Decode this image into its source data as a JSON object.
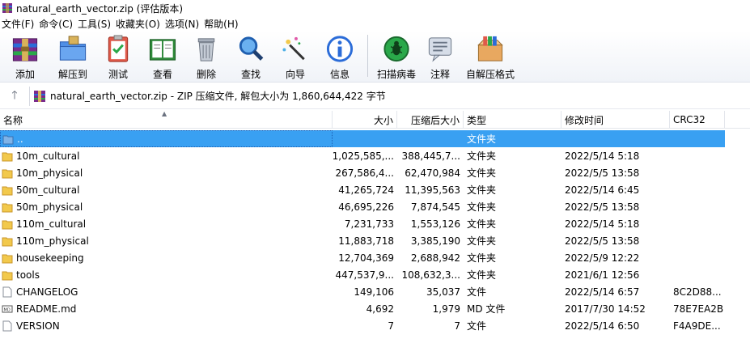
{
  "window": {
    "title": "natural_earth_vector.zip (评估版本)"
  },
  "menu": [
    "文件(F)",
    "命令(C)",
    "工具(S)",
    "收藏夹(O)",
    "选项(N)",
    "帮助(H)"
  ],
  "toolbar": {
    "add": "添加",
    "extract": "解压到",
    "test": "测试",
    "view": "查看",
    "delete": "删除",
    "find": "查找",
    "wizard": "向导",
    "info": "信息",
    "scan": "扫描病毒",
    "comment": "注释",
    "sfx": "自解压格式"
  },
  "address": {
    "path": "natural_earth_vector.zip - ZIP 压缩文件, 解包大小为 1,860,644,422 字节"
  },
  "columns": {
    "name": "名称",
    "size": "大小",
    "packed": "压缩后大小",
    "type": "类型",
    "modified": "修改时间",
    "crc": "CRC32"
  },
  "files": [
    {
      "name": "..",
      "size": "",
      "packed": "",
      "type": "文件夹",
      "modified": "",
      "crc": "",
      "icon": "up-folder-icon",
      "selected": true
    },
    {
      "name": "10m_cultural",
      "size": "1,025,585,...",
      "packed": "388,445,7...",
      "type": "文件夹",
      "modified": "2022/5/14 5:18",
      "crc": "",
      "icon": "folder-icon"
    },
    {
      "name": "10m_physical",
      "size": "267,586,4...",
      "packed": "62,470,984",
      "type": "文件夹",
      "modified": "2022/5/5 13:58",
      "crc": "",
      "icon": "folder-icon"
    },
    {
      "name": "50m_cultural",
      "size": "41,265,724",
      "packed": "11,395,563",
      "type": "文件夹",
      "modified": "2022/5/14 6:45",
      "crc": "",
      "icon": "folder-icon"
    },
    {
      "name": "50m_physical",
      "size": "46,695,226",
      "packed": "7,874,545",
      "type": "文件夹",
      "modified": "2022/5/5 13:58",
      "crc": "",
      "icon": "folder-icon"
    },
    {
      "name": "110m_cultural",
      "size": "7,231,733",
      "packed": "1,553,126",
      "type": "文件夹",
      "modified": "2022/5/14 5:18",
      "crc": "",
      "icon": "folder-icon"
    },
    {
      "name": "110m_physical",
      "size": "11,883,718",
      "packed": "3,385,190",
      "type": "文件夹",
      "modified": "2022/5/5 13:58",
      "crc": "",
      "icon": "folder-icon"
    },
    {
      "name": "housekeeping",
      "size": "12,704,369",
      "packed": "2,688,942",
      "type": "文件夹",
      "modified": "2022/5/9 12:22",
      "crc": "",
      "icon": "folder-icon"
    },
    {
      "name": "tools",
      "size": "447,537,9...",
      "packed": "108,632,3...",
      "type": "文件夹",
      "modified": "2021/6/1 12:56",
      "crc": "",
      "icon": "folder-icon"
    },
    {
      "name": "CHANGELOG",
      "size": "149,106",
      "packed": "35,037",
      "type": "文件",
      "modified": "2022/5/14 6:57",
      "crc": "8C2D88...",
      "icon": "file-icon"
    },
    {
      "name": "README.md",
      "size": "4,692",
      "packed": "1,979",
      "type": "MD 文件",
      "modified": "2017/7/30 14:52",
      "crc": "78E7EA2B",
      "icon": "md-file-icon"
    },
    {
      "name": "VERSION",
      "size": "7",
      "packed": "7",
      "type": "文件",
      "modified": "2022/5/14 6:50",
      "crc": "F4A9DE...",
      "icon": "file-icon"
    }
  ],
  "colors": {
    "selection": "#39a0f2",
    "folder": "#f2c94c",
    "toolbar_bg": "#f0f3f8"
  }
}
